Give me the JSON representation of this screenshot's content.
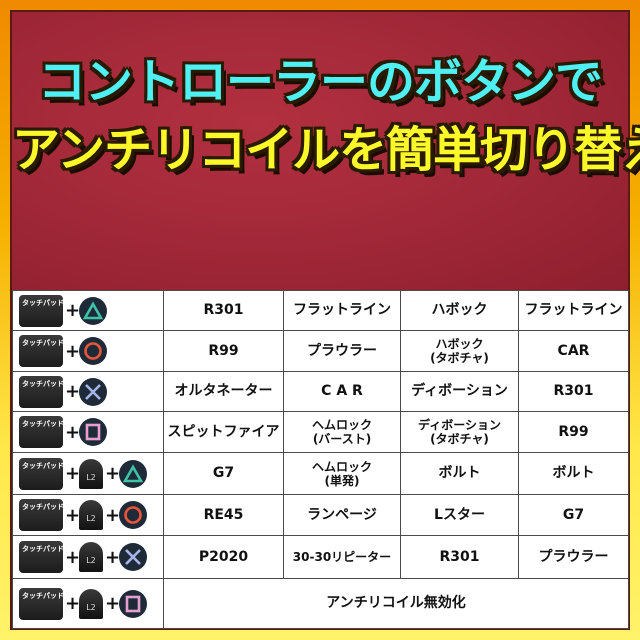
{
  "title": {
    "line1": "コントローラーのボタンで",
    "line2": "アンチリコイルを簡単切り替え"
  },
  "labels": {
    "touchpad": "タッチパッド",
    "plus": "+",
    "l2": "L2"
  },
  "colors": {
    "title1": "#4ff0f4",
    "title2": "#fbf82a",
    "banner": "#a52a3a",
    "frame": "#f5b000",
    "triangle": "#3ec3a6",
    "circle": "#e8563a",
    "cross": "#a6b4e8",
    "square": "#e6a0d0"
  },
  "rows": [
    {
      "combo": [
        "touchpad",
        "triangle"
      ],
      "cells": [
        "R301",
        "フラットライン",
        "ハボック",
        "フラットライン"
      ]
    },
    {
      "combo": [
        "touchpad",
        "circle"
      ],
      "cells": [
        "R99",
        "プラウラー",
        "ハボック\n(タボチャ)",
        "CAR"
      ]
    },
    {
      "combo": [
        "touchpad",
        "cross"
      ],
      "cells": [
        "オルタネーター",
        "C A R",
        "ディボーション",
        "R301"
      ]
    },
    {
      "combo": [
        "touchpad",
        "square"
      ],
      "cells": [
        "スピットファイア",
        "ヘムロック\n(バースト)",
        "ディボーション\n(タボチャ)",
        "R99"
      ]
    },
    {
      "combo": [
        "touchpad",
        "l2",
        "triangle"
      ],
      "cells": [
        "G7",
        "ヘムロック\n(単発)",
        "ボルト",
        "ボルト"
      ]
    },
    {
      "combo": [
        "touchpad",
        "l2",
        "circle"
      ],
      "cells": [
        "RE45",
        "ランページ",
        "Lスター",
        "G7"
      ]
    },
    {
      "combo": [
        "touchpad",
        "l2",
        "cross"
      ],
      "cells": [
        "P2020",
        "30-30リピーター",
        "R301",
        "プラウラー"
      ]
    },
    {
      "combo": [
        "touchpad",
        "l2",
        "square"
      ],
      "merged": "アンチリコイル無効化"
    }
  ]
}
